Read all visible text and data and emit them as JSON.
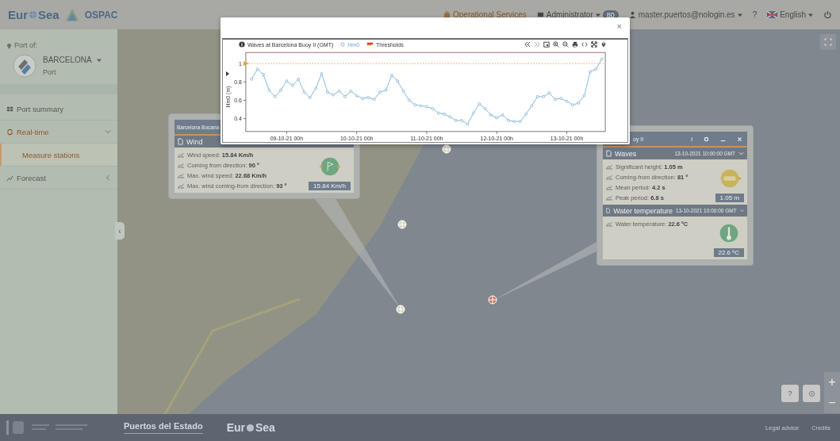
{
  "header": {
    "brand": {
      "start": "Eur",
      "end": "Sea"
    },
    "ospac": "OSPAC",
    "operational_services": "Operational Services",
    "role": "Administrator",
    "role_badge": "80",
    "user": "master.puertos@nologin.es",
    "help": "?",
    "language": "English"
  },
  "sidebar": {
    "port_label": "Port of:",
    "port_name": "BARCELONA",
    "port_type": "Port",
    "collapse": "‹",
    "menu": [
      {
        "kind": "summary",
        "label": "Port summary",
        "selected": false
      },
      {
        "kind": "realtime",
        "label": "Real-time",
        "selected": true,
        "expanded": true,
        "children": [
          {
            "label": "Measure stations",
            "selected": true
          }
        ]
      },
      {
        "kind": "forecast",
        "label": "Forecast",
        "selected": false,
        "expanded": false
      }
    ]
  },
  "map": {
    "controls": {
      "help": "?",
      "zoom_in": "+",
      "zoom_out": "−"
    },
    "wind_card": {
      "title": "Barcelona Bocana",
      "section": "Wind",
      "rows": [
        "Wind speed: **15.84 Km/h**",
        "Coming from direction: **90 º**",
        "Max. wind speed: **22.68 Km/h**",
        "Max. wind coming-from direction: **93 º**"
      ],
      "reading": "15.84 Km/h"
    },
    "buoy_card": {
      "title": "oy II",
      "info": "i",
      "sections": [
        {
          "kind": "waves",
          "title": "Waves",
          "time": "13-10-2021 10:00:00 GMT",
          "rows": [
            "Significant height: **1.05 m**",
            "Coming-from direction: **81 º**",
            "Mean period: **4.2 s**",
            "Peak period: **6.8 s**"
          ],
          "reading": "1.05 m"
        },
        {
          "kind": "temperature",
          "title": "Water temperature",
          "time": "13-10-2021 10:00:00 GMT",
          "rows": [
            "Water temperature: **22.6 ºC**"
          ],
          "reading": "22.6 ºC"
        }
      ]
    }
  },
  "modal": {
    "close": "×",
    "chart": {
      "threshold_legend": "Thresholds",
      "chart_data": {
        "type": "line",
        "title": "Waves at Barcelona Buoy II (GMT)",
        "ylabel": "Hm0 (m)",
        "categories": [
          null,
          null,
          null,
          null,
          null,
          null,
          "09-10-21 00h",
          null,
          null,
          null,
          null,
          null,
          null,
          null,
          null,
          null,
          null,
          null,
          "10-10-21 00h",
          null,
          null,
          null,
          null,
          null,
          null,
          null,
          null,
          null,
          null,
          null,
          "11-10-21 00h",
          null,
          null,
          null,
          null,
          null,
          null,
          null,
          null,
          null,
          null,
          null,
          "12-10-21 00h",
          null,
          null,
          null,
          null,
          null,
          null,
          null,
          null,
          null,
          null,
          null,
          "13-10-21 00h",
          null,
          null,
          null,
          null,
          null,
          null
        ],
        "series": [
          {
            "name": "Hm0",
            "color": "#6aa6cc",
            "marker": "o",
            "values": [
              0.83,
              0.94,
              0.88,
              0.71,
              0.64,
              0.71,
              0.81,
              0.76,
              0.83,
              0.69,
              0.63,
              0.73,
              0.89,
              0.69,
              0.66,
              0.7,
              0.64,
              0.7,
              0.65,
              0.62,
              0.63,
              0.61,
              0.69,
              0.71,
              0.87,
              0.81,
              0.7,
              0.6,
              0.55,
              0.54,
              0.53,
              0.51,
              0.46,
              0.45,
              0.42,
              0.38,
              0.38,
              0.34,
              0.46,
              0.56,
              0.51,
              0.44,
              0.41,
              0.44,
              0.38,
              0.37,
              0.37,
              0.45,
              0.54,
              0.64,
              0.64,
              0.68,
              0.61,
              0.62,
              0.59,
              0.55,
              0.57,
              0.65,
              0.91,
              0.94,
              1.05
            ]
          }
        ],
        "ylim": [
          0.26,
          1.12
        ],
        "yticks": [
          0.4,
          0.6,
          0.8,
          1
        ],
        "ref_lines": [
          {
            "axis": "y",
            "value": 1,
            "color": "#f0a030"
          }
        ]
      }
    }
  },
  "footer": {
    "agency": "Puertos del Estado",
    "brand": {
      "start": "Eur",
      "end": "Sea"
    },
    "links": [
      "Legal advice",
      "Credits"
    ]
  }
}
